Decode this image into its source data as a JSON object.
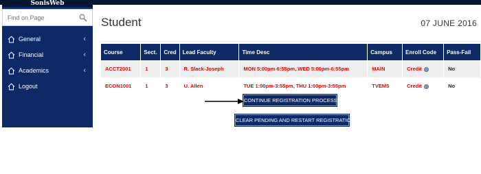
{
  "app": {
    "brand": "SonisWeb"
  },
  "sidebar": {
    "search_placeholder": "Find on Page",
    "items": [
      {
        "label": "General",
        "has_submenu": true
      },
      {
        "label": "Financial",
        "has_submenu": true
      },
      {
        "label": "Academics",
        "has_submenu": true
      },
      {
        "label": "Logout",
        "has_submenu": false
      }
    ]
  },
  "header": {
    "title": "Student",
    "date": "07 JUNE 2016"
  },
  "table": {
    "columns": [
      "Course",
      "Sect.",
      "Cred",
      "Lead Faculty",
      "Time Desc",
      "Campus",
      "Enroll Code",
      "Pass-Fail"
    ],
    "rows": [
      {
        "course": "ACCT2001",
        "sect": "1",
        "cred": "3",
        "faculty": "R. Slack-Joseph",
        "time": "MON 5:00pm-6:55pm, WED 5:00pm-6:55pm",
        "campus": "MAIN",
        "enroll": "Credit",
        "passfail": "No"
      },
      {
        "course": "ECON1001",
        "sect": "1",
        "cred": "3",
        "faculty": "U. Allen",
        "time": "TUE 1:00pm-3:55pm, THU 1:00pm-3:55pm",
        "campus": "TVEM5",
        "enroll": "Credit",
        "passfail": "No"
      }
    ]
  },
  "actions": {
    "continue_label": "CONTINUE REGISTRATION PROCESS",
    "clear_label": "CLEAR PENDING AND RESTART REGISTRATION"
  },
  "colors": {
    "navy": "#0d2a66",
    "accent_red": "#e60000",
    "row_alt": "#eeeeee"
  }
}
